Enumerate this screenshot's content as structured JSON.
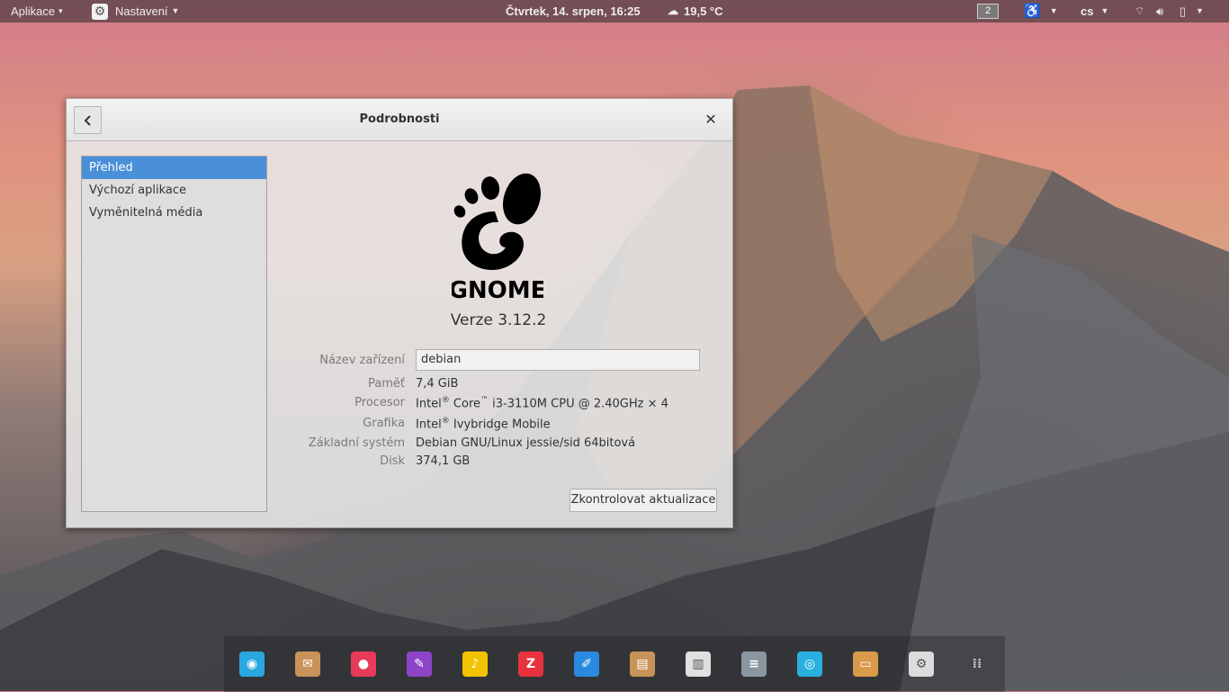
{
  "top_panel": {
    "apps_menu": "Aplikace",
    "app_menu": "Nastavení",
    "clock": "Čtvrtek, 14. srpen, 16:25",
    "weather": "19,5 °C",
    "workspace": "2",
    "keyboard_layout": "cs",
    "icons": [
      "gear-icon",
      "cloud-icon",
      "accessibility-icon",
      "wifi-icon",
      "volume-icon",
      "battery-icon"
    ]
  },
  "dialog": {
    "title": "Podrobnosti",
    "sidebar": [
      "Přehled",
      "Výchozí aplikace",
      "Vyměnitelná média"
    ],
    "selected": 0,
    "logo_text": "GNOME",
    "version": "Verze 3.12.2",
    "device_name_label": "Název zařízení",
    "device_name_value": "debian",
    "memory_label": "Paměť",
    "memory_value": "7,4 GiB",
    "processor_label": "Procesor",
    "processor": {
      "intel": "Intel",
      "reg": "®",
      "core": " Core",
      "tm": "™",
      "rest": " i3-3110M CPU @ 2.40GHz × 4"
    },
    "graphics_label": "Grafika",
    "graphics": {
      "intel": "Intel",
      "reg": "®",
      "rest": " Ivybridge Mobile"
    },
    "os_label": "Základní systém",
    "os_value": "Debian GNU/Linux jessie/sid 64bitová",
    "disk_label": "Disk",
    "disk_value": "374,1 GB",
    "update_button": "Zkontrolovat aktualizace"
  },
  "dock": {
    "items": [
      {
        "name": "web-browser-icon",
        "color": "#29a8e0"
      },
      {
        "name": "mail-icon",
        "color": "#c9925a"
      },
      {
        "name": "music-player-icon",
        "color": "#e83a5a"
      },
      {
        "name": "paint-brush-icon",
        "color": "#8e44c8"
      },
      {
        "name": "music-note-icon",
        "color": "#f3c300"
      },
      {
        "name": "filezilla-icon",
        "color": "#e8323e"
      },
      {
        "name": "text-editor-icon",
        "color": "#2a8ae0"
      },
      {
        "name": "archive-icon",
        "color": "#c89358"
      },
      {
        "name": "document-viewer-icon",
        "color": "#e0e0e0"
      },
      {
        "name": "mixer-icon",
        "color": "#8a96a0"
      },
      {
        "name": "camera-icon",
        "color": "#2ab0e0"
      },
      {
        "name": "files-icon",
        "color": "#d99a4a"
      },
      {
        "name": "settings-icon",
        "color": "#dcdcdc"
      },
      {
        "name": "app-grid-icon",
        "color": "#7a7a7a"
      }
    ]
  }
}
